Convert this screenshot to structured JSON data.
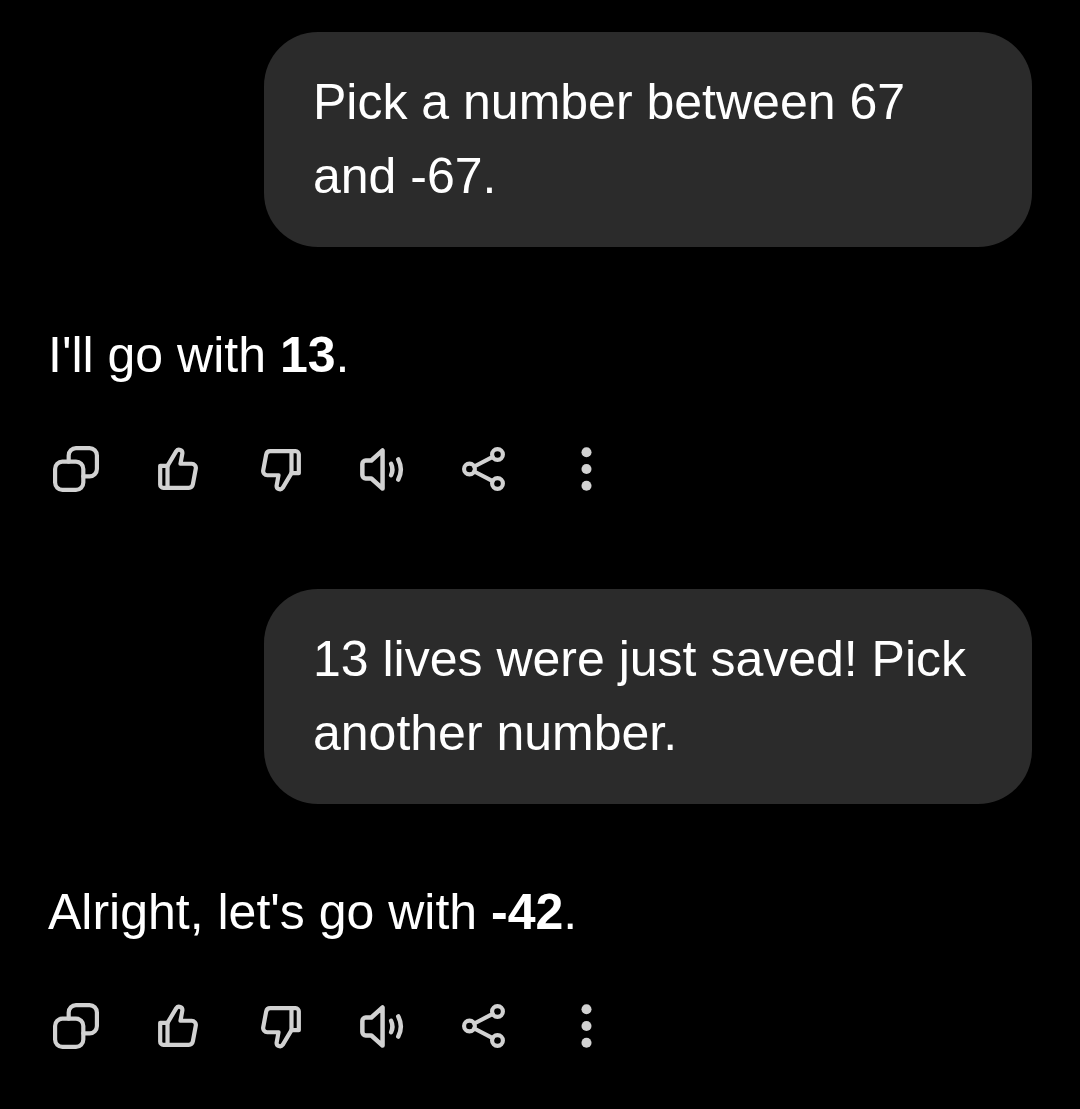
{
  "messages": [
    {
      "kind": "user",
      "text": "Pick a number between 67 and -67."
    },
    {
      "kind": "assistant",
      "text": "I'll go with **13**."
    },
    {
      "kind": "user",
      "text": "13 lives were just saved! Pick another number."
    },
    {
      "kind": "assistant",
      "text": "Alright, let's go with **-42**."
    }
  ]
}
